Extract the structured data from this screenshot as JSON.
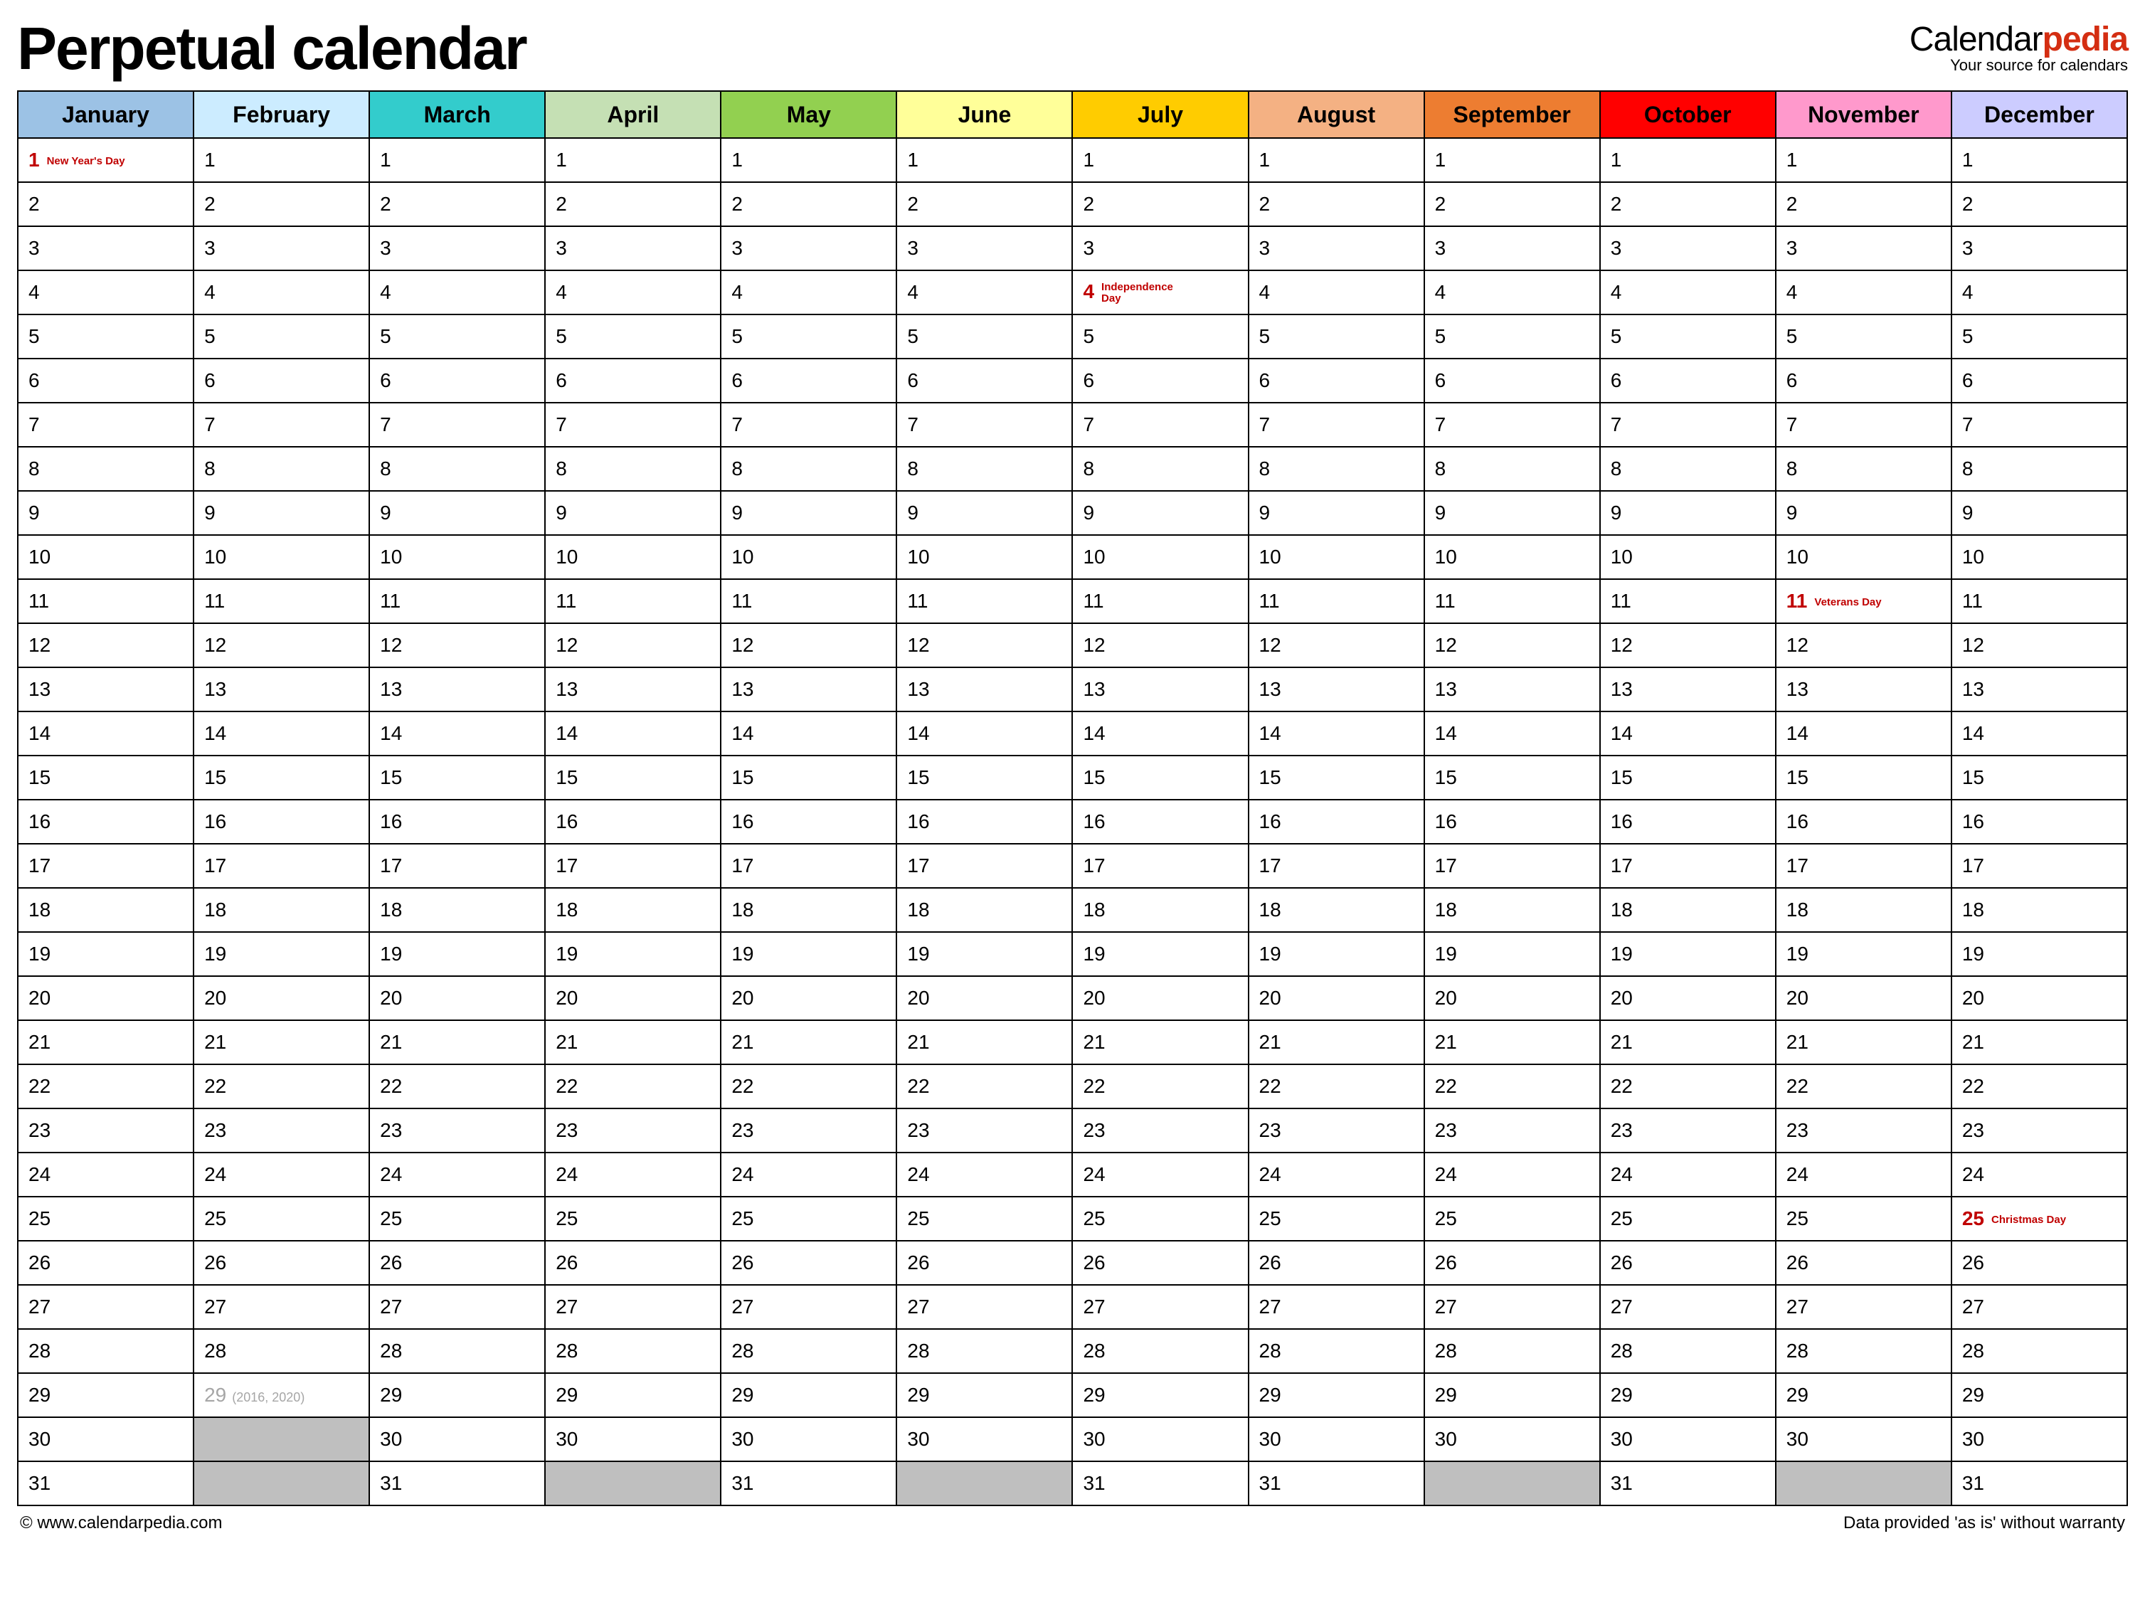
{
  "title": "Perpetual calendar",
  "brand": {
    "prefix": "Calendar",
    "accent": "pedia",
    "tagline": "Your source for calendars"
  },
  "footer": {
    "left": "© www.calendarpedia.com",
    "right": "Data provided 'as is' without warranty"
  },
  "months": [
    {
      "name": "January",
      "color": "#9cc2e5",
      "days": 31,
      "holidays": {
        "1": "New Year's Day"
      }
    },
    {
      "name": "February",
      "color": "#ccecff",
      "days": 28,
      "leap": {
        "day": 29,
        "note": "(2016, 2020)"
      }
    },
    {
      "name": "March",
      "color": "#33cccc",
      "days": 31
    },
    {
      "name": "April",
      "color": "#c5e0b4",
      "days": 30
    },
    {
      "name": "May",
      "color": "#92d050",
      "days": 31
    },
    {
      "name": "June",
      "color": "#ffff99",
      "days": 30
    },
    {
      "name": "July",
      "color": "#ffcc00",
      "days": 31,
      "holidays": {
        "4": "Independence Day"
      }
    },
    {
      "name": "August",
      "color": "#f4b183",
      "days": 31
    },
    {
      "name": "September",
      "color": "#ed7d31",
      "days": 30
    },
    {
      "name": "October",
      "color": "#ff0000",
      "days": 31
    },
    {
      "name": "November",
      "color": "#ff99cc",
      "days": 30,
      "holidays": {
        "11": "Veterans Day"
      }
    },
    {
      "name": "December",
      "color": "#ccccff",
      "days": 31,
      "holidays": {
        "25": "Christmas Day"
      }
    }
  ],
  "max_rows": 31
}
